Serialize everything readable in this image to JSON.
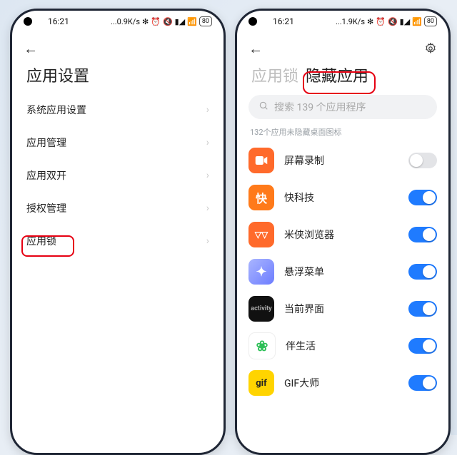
{
  "status": {
    "time": "16:21",
    "net_left": "0.9K/s",
    "net_right": "1.9K/s",
    "bt_icon": "✻",
    "alarm_icon": "⏰",
    "mute_icon": "🔇",
    "signal_icon": "▮◢",
    "wifi_icon": "📶",
    "battery": "80"
  },
  "left_screen": {
    "title": "应用设置",
    "items": [
      {
        "label": "系统应用设置"
      },
      {
        "label": "应用管理"
      },
      {
        "label": "应用双开"
      },
      {
        "label": "授权管理"
      },
      {
        "label": "应用锁"
      }
    ]
  },
  "right_screen": {
    "tab_inactive": "应用锁",
    "tab_active": "隐藏应用",
    "search_placeholder": "搜索 139 个应用程序",
    "hint": "132个应用未隐藏桌面图标",
    "apps": [
      {
        "name": "屏幕录制",
        "icon_glyph": "■",
        "icon_class": "ic-rec",
        "on": false
      },
      {
        "name": "快科技",
        "icon_glyph": "快",
        "icon_class": "ic-kuai",
        "on": true
      },
      {
        "name": "米侠浏览器",
        "icon_glyph": "◥◣",
        "icon_class": "ic-mi",
        "on": true
      },
      {
        "name": "悬浮菜单",
        "icon_glyph": "✦",
        "icon_class": "ic-float",
        "on": true
      },
      {
        "name": "当前界面",
        "icon_glyph": "≡",
        "icon_class": "ic-cur",
        "on": true
      },
      {
        "name": "伴生活",
        "icon_glyph": "✿",
        "icon_class": "ic-ban",
        "on": true
      },
      {
        "name": "GIF大师",
        "icon_glyph": "gif",
        "icon_class": "ic-gif",
        "on": true
      }
    ]
  }
}
